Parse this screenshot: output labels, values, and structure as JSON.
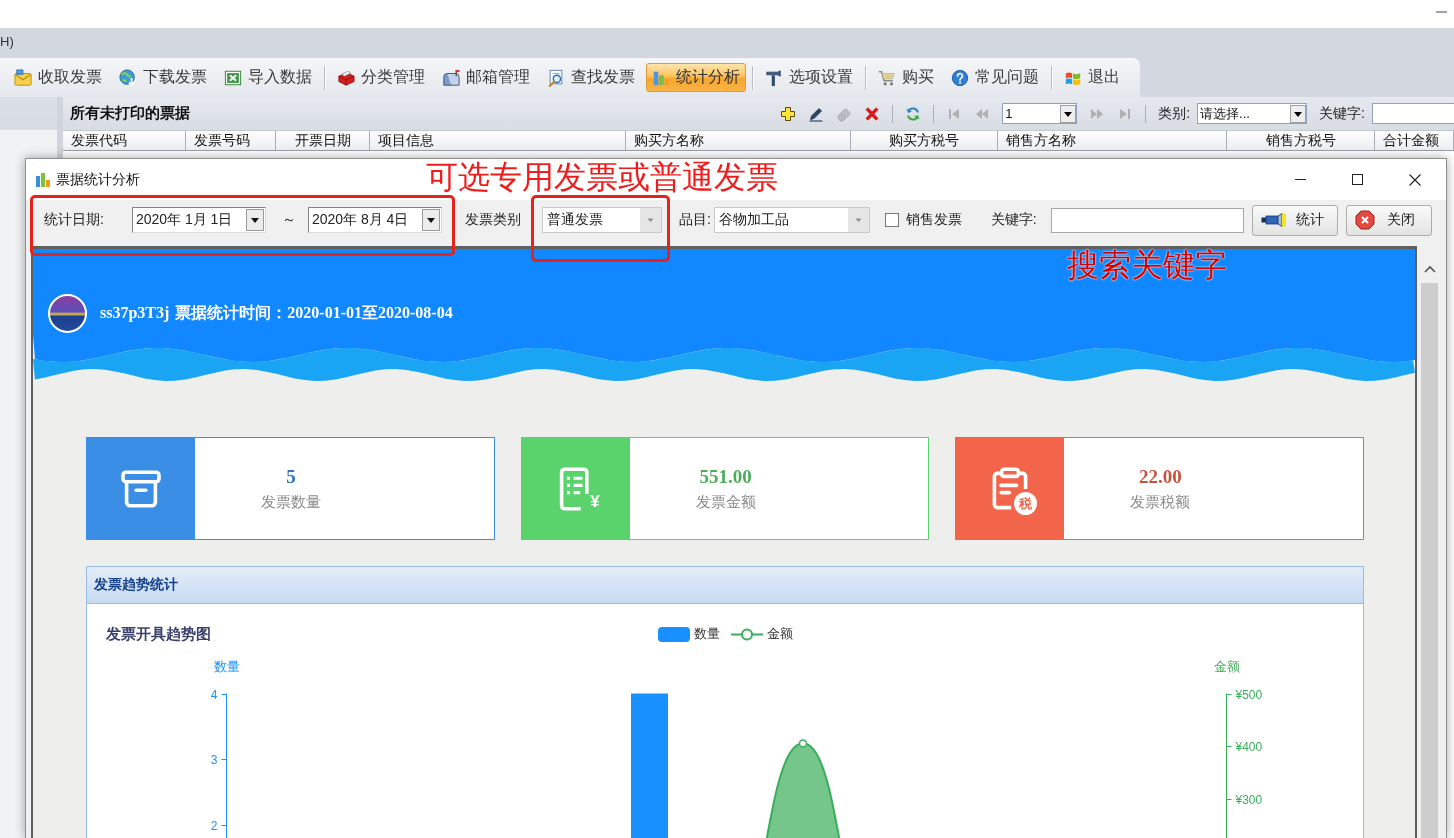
{
  "menu_bar": [
    "H)"
  ],
  "toolbar": {
    "groups": [
      [
        {
          "label": "收取发票",
          "selected": false
        },
        {
          "label": "下载发票",
          "selected": false
        },
        {
          "label": "导入数据",
          "selected": false
        }
      ],
      [
        {
          "label": "分类管理",
          "selected": false
        },
        {
          "label": "邮箱管理",
          "selected": false
        },
        {
          "label": "查找发票",
          "selected": false
        },
        {
          "label": "统计分析",
          "selected": true
        }
      ],
      [
        {
          "label": "选项设置",
          "selected": false
        }
      ],
      [
        {
          "label": "购买",
          "selected": false
        },
        {
          "label": "常见问题",
          "selected": false
        }
      ],
      [
        {
          "label": "退出",
          "selected": false
        }
      ]
    ]
  },
  "grid": {
    "title": "所有未打印的票据",
    "tools": [
      {
        "disabled": false
      },
      {
        "disabled": false
      },
      {
        "disabled": true
      },
      {
        "disabled": false
      },
      {
        "disabled": false
      }
    ],
    "pager": {
      "buttons": [
        {
          "disabled": true
        },
        {
          "disabled": true
        },
        {
          "disabled": true
        },
        {
          "disabled": true
        }
      ],
      "page": "1"
    },
    "category": {
      "label": "类别:",
      "value": "请选择..."
    },
    "keyword": {
      "label": "关键字:"
    },
    "columns": [
      "发票代码",
      "发票号码",
      "开票日期",
      "项目信息",
      "购买方名称",
      "购买方税号",
      "销售方名称",
      "销售方税号",
      "合计金额"
    ]
  },
  "dialog": {
    "title": "票据统计分析",
    "toolbar": {
      "date_range": {
        "label": "统计日期:",
        "from": "2020年 1月 1日",
        "separator": "～",
        "to": "2020年 8月 4日",
        "highlighted": true
      },
      "invoice_type": {
        "label": "发票类别",
        "value": "普通发票",
        "highlighted": true,
        "note": "可选专用发票或普通发票"
      },
      "item": {
        "label": "品目:",
        "value": "谷物加工品"
      },
      "sales_invoice": {
        "label": "销售发票",
        "checked": false
      },
      "keyword": {
        "label": "关键字:",
        "note": "搜索关键字"
      },
      "buttons": [
        {
          "label": "统计"
        },
        {
          "label": "关闭"
        }
      ]
    },
    "report": {
      "user": "ss37p3T3j",
      "period": "票据统计时间：2020-01-01至2020-08-04",
      "stats": [
        {
          "value": "5",
          "label": "发票数量",
          "color": "#3a8ee6"
        },
        {
          "value": "551.00",
          "label": "发票金额",
          "color": "#5bd36c",
          "badge": {
            "kind": "plain",
            "text": "¥"
          }
        },
        {
          "value": "22.00",
          "label": "发票税额",
          "color": "#f2654a",
          "badge": {
            "kind": "disc",
            "text": "税"
          }
        }
      ],
      "panel": {
        "title": "发票趋势统计",
        "chart": {
          "title": "发票开具趋势图",
          "legend": [
            {
              "label": "数量",
              "kind": "bar",
              "color": "#1890ff"
            },
            {
              "label": "金额",
              "kind": "line",
              "color": "#3aae5a"
            }
          ],
          "left_axis": {
            "title": "数量",
            "ticks": [
              "4",
              "3",
              "2"
            ]
          },
          "right_axis": {
            "title": "金额",
            "ticks": [
              "¥500",
              "¥400",
              "¥300"
            ]
          }
        }
      }
    }
  }
}
